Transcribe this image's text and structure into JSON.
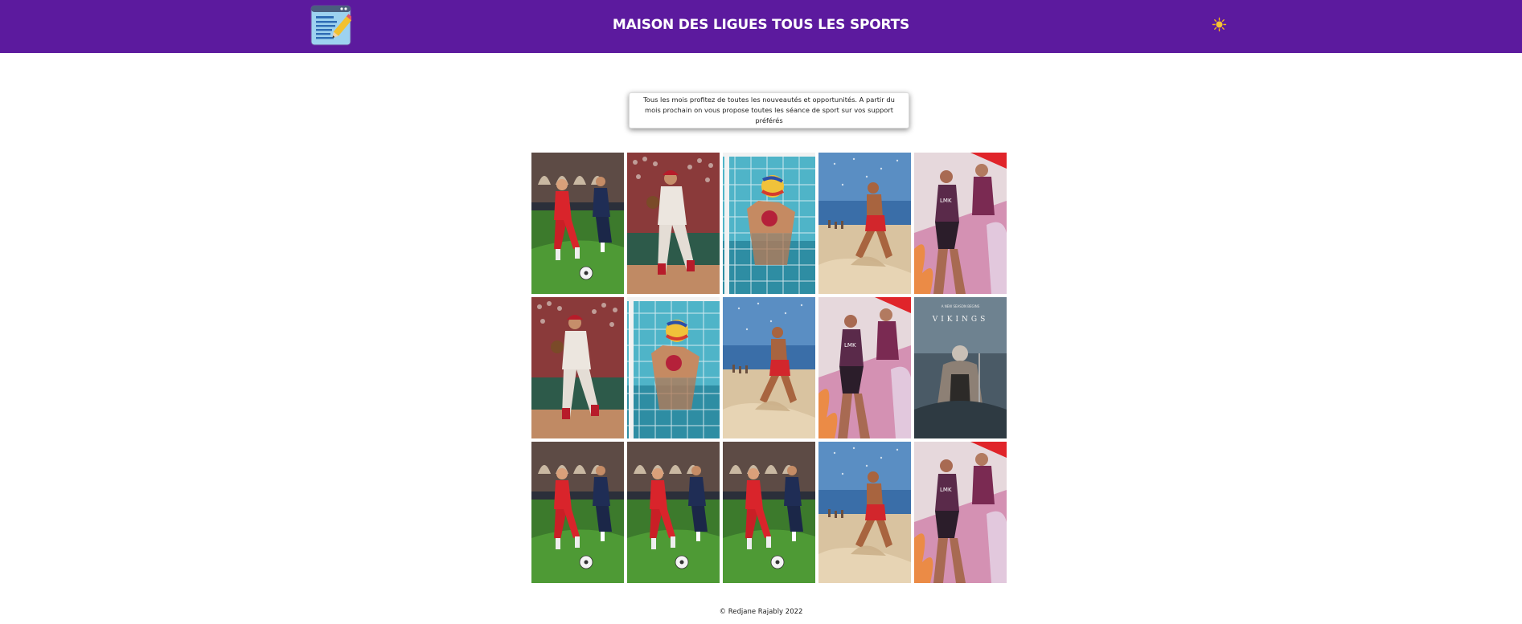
{
  "header": {
    "title": "MAISON DES LIGUES TOUS LES SPORTS",
    "logo_icon": "notepad-pencil-icon",
    "theme_toggle_icon": "sun-icon",
    "background_color": "#5c1a9e"
  },
  "promo": {
    "text": "Tous les mois profitez de toutes les nouveautés et opportunités. A partir du mois prochain on vous propose toutes les séance de sport sur vos support préférés"
  },
  "gallery": {
    "tiles": [
      {
        "subject": "football"
      },
      {
        "subject": "baseball"
      },
      {
        "subject": "water-polo"
      },
      {
        "subject": "beach-runner"
      },
      {
        "subject": "track-runners"
      },
      {
        "subject": "baseball"
      },
      {
        "subject": "water-polo"
      },
      {
        "subject": "beach-runner"
      },
      {
        "subject": "track-runners"
      },
      {
        "subject": "vikings",
        "poster_top_text": "A NEW SEASON BEGINS",
        "poster_title": "VIKINGS"
      },
      {
        "subject": "football"
      },
      {
        "subject": "football"
      },
      {
        "subject": "football"
      },
      {
        "subject": "beach-runner"
      },
      {
        "subject": "track-runners"
      }
    ]
  },
  "footer": {
    "text": "© Redjane Rajably 2022"
  }
}
